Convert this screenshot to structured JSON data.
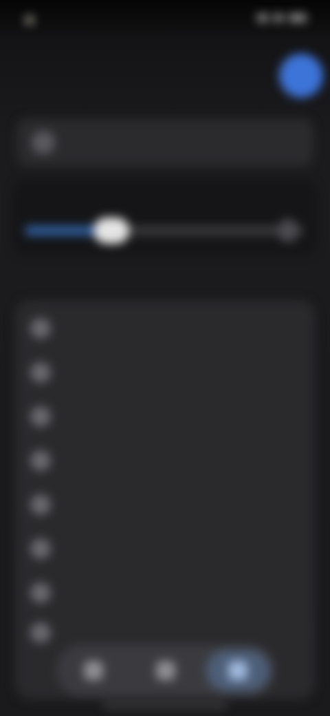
{
  "status_bar": {
    "time": "",
    "icons": [
      "signal-icon",
      "wifi-icon",
      "battery-icon"
    ]
  },
  "header": {
    "title": "",
    "avatar_initial": ""
  },
  "account": {
    "label": "",
    "icon": "account-icon"
  },
  "volume": {
    "label": "",
    "level": 0.31
  },
  "list": {
    "section_label": "",
    "items": [
      {
        "label": "",
        "icon": "item-icon"
      },
      {
        "label": "",
        "icon": "item-icon"
      },
      {
        "label": "",
        "icon": "item-icon"
      },
      {
        "label": "",
        "icon": "item-icon"
      },
      {
        "label": "",
        "icon": "item-icon"
      },
      {
        "label": "",
        "icon": "item-icon"
      },
      {
        "label": "",
        "icon": "item-icon"
      },
      {
        "label": "",
        "icon": "item-icon"
      }
    ]
  },
  "tab_bar": {
    "tabs": [
      {
        "icon": "tab-icon",
        "active": false
      },
      {
        "icon": "tab-icon",
        "active": false
      },
      {
        "icon": "tab-icon",
        "active": true
      }
    ]
  },
  "colors": {
    "accent": "#3d74d8",
    "background": "#1a1a1c",
    "card": "#2a2a2d"
  }
}
